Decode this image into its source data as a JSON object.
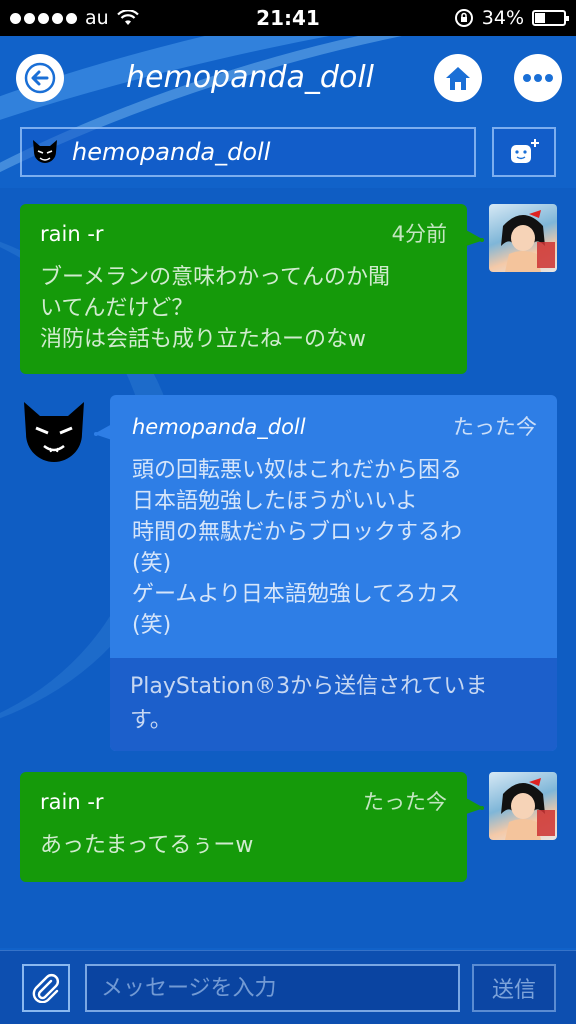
{
  "status_bar": {
    "carrier": "au",
    "time": "21:41",
    "battery": "34%",
    "battery_level": 0.34
  },
  "header": {
    "title": "hemopanda_doll"
  },
  "friend_bar": {
    "name": "hemopanda_doll"
  },
  "messages": [
    {
      "sender": "rain -r",
      "time": "4分前",
      "text": "ブーメランの意味わかってんのか聞\nいてんだけど？\n消防は会話も成り立たねーのなw",
      "side": "right",
      "color": "#159a0a"
    },
    {
      "sender": "hemopanda_doll",
      "time": "たった今",
      "text": "頭の回転悪い奴はこれだから困る\n日本語勉強したほうがいいよ\n時間の無駄だからブロックするわ\n(笑)\nゲームより日本語勉強してろカス\n(笑)",
      "footer": "PlayStation®3から送信されていま\nす。",
      "side": "left",
      "color": "#2e7ee6"
    },
    {
      "sender": "rain -r",
      "time": "たった今",
      "text": "あったまってるぅーw",
      "side": "right",
      "color": "#159a0a"
    }
  ],
  "input_bar": {
    "placeholder": "メッセージを入力",
    "send_label": "送信"
  },
  "icons": {
    "back": "back-arrow-icon",
    "home": "home-icon",
    "more": "more-icon",
    "add_friend": "add-friend-icon",
    "attach": "paperclip-icon"
  }
}
